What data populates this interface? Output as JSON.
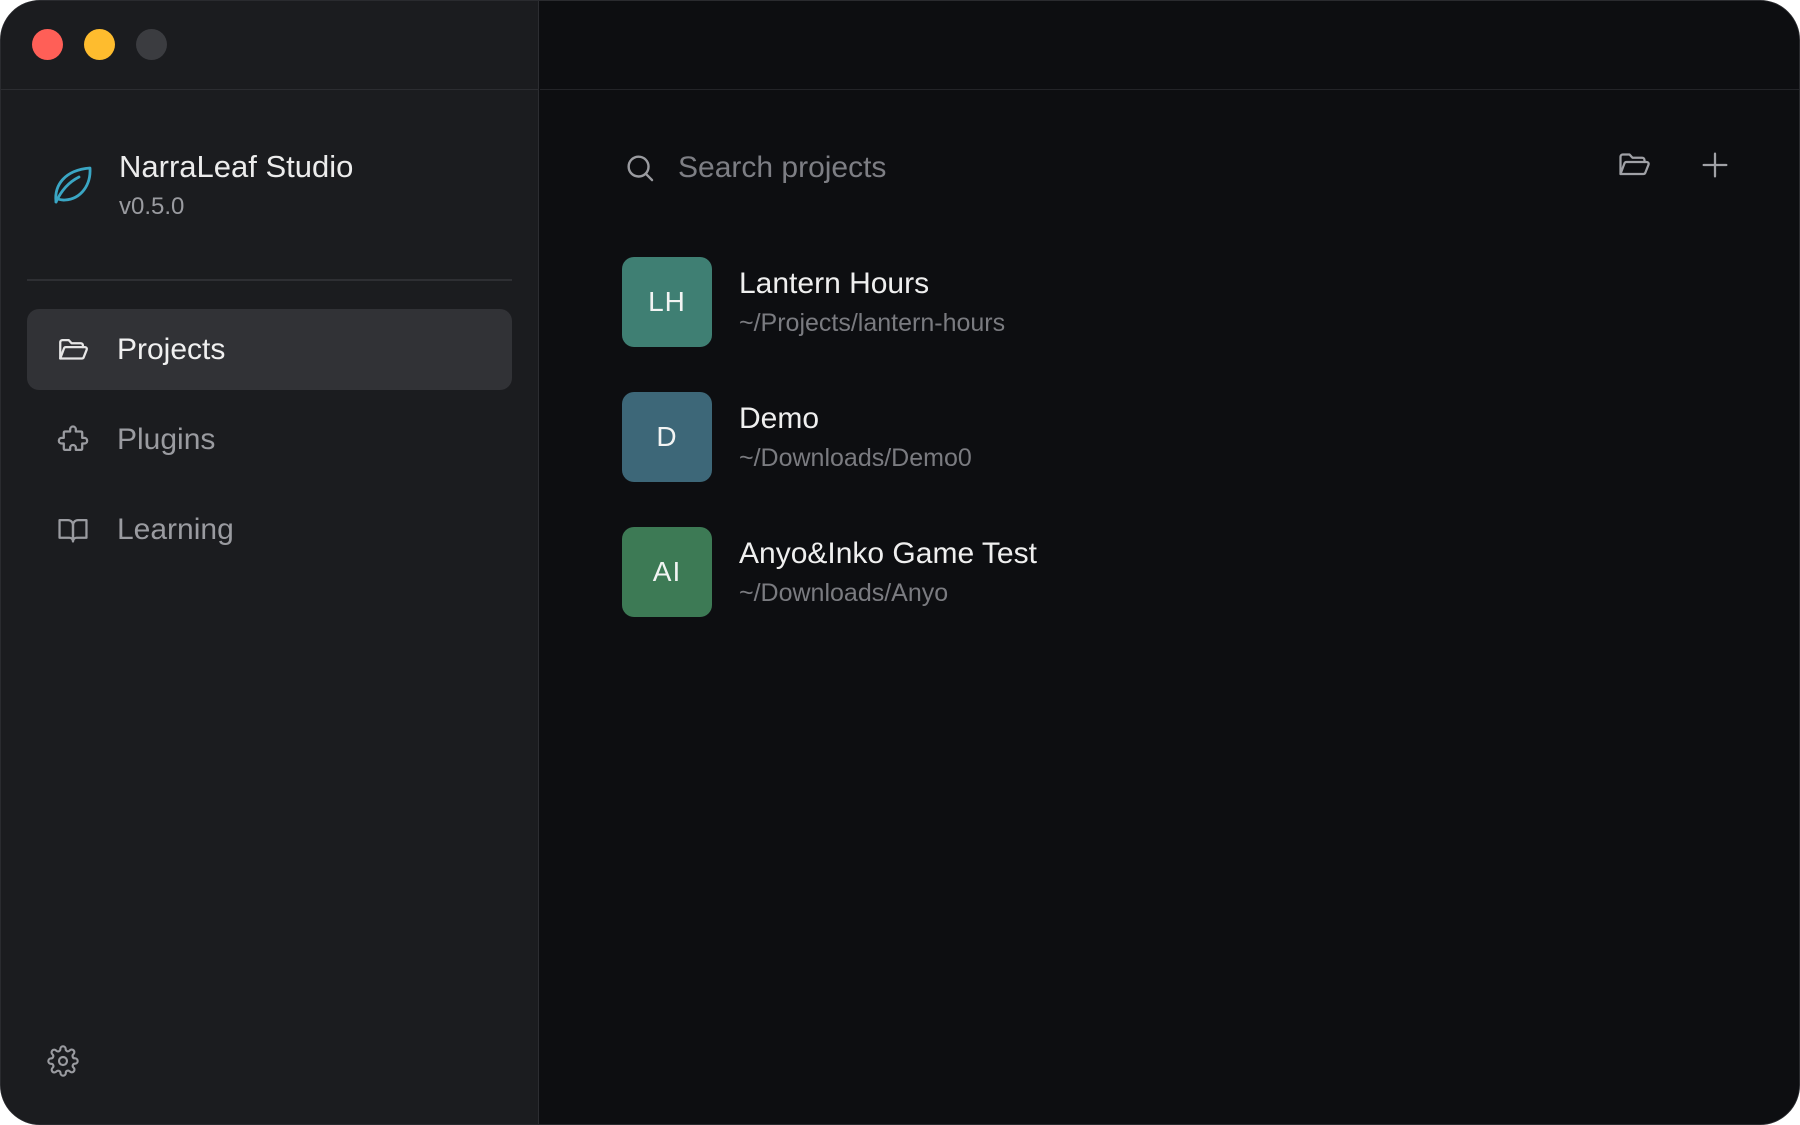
{
  "window": {
    "controls": [
      {
        "name": "close",
        "color": "#ff5f57"
      },
      {
        "name": "minimize",
        "color": "#febc2e"
      },
      {
        "name": "zoom-disabled",
        "color": "#3b3c40"
      }
    ]
  },
  "sidebar": {
    "brand": {
      "name": "NarraLeaf Studio",
      "version": "v0.5.0",
      "logo_icon": "leaf-icon",
      "logo_color": "#3aa6c4"
    },
    "items": [
      {
        "label": "Projects",
        "icon": "folder-open-icon",
        "active": true
      },
      {
        "label": "Plugins",
        "icon": "puzzle-icon",
        "active": false
      },
      {
        "label": "Learning",
        "icon": "book-open-icon",
        "active": false
      }
    ],
    "settings_icon": "gear-icon"
  },
  "main": {
    "search": {
      "placeholder": "Search projects",
      "value": "",
      "icon": "search-icon"
    },
    "toolbar": {
      "open_icon": "folder-open-icon",
      "add_icon": "plus-icon"
    },
    "projects": [
      {
        "initials": "LH",
        "name": "Lantern Hours",
        "path": "~/Projects/lantern-hours",
        "color": "#3f7f73"
      },
      {
        "initials": "D",
        "name": "Demo",
        "path": "~/Downloads/Demo0",
        "color": "#3d6778"
      },
      {
        "initials": "AI",
        "name": "Anyo&Inko Game Test",
        "path": "~/Downloads/Anyo",
        "color": "#3d7a55"
      }
    ]
  }
}
